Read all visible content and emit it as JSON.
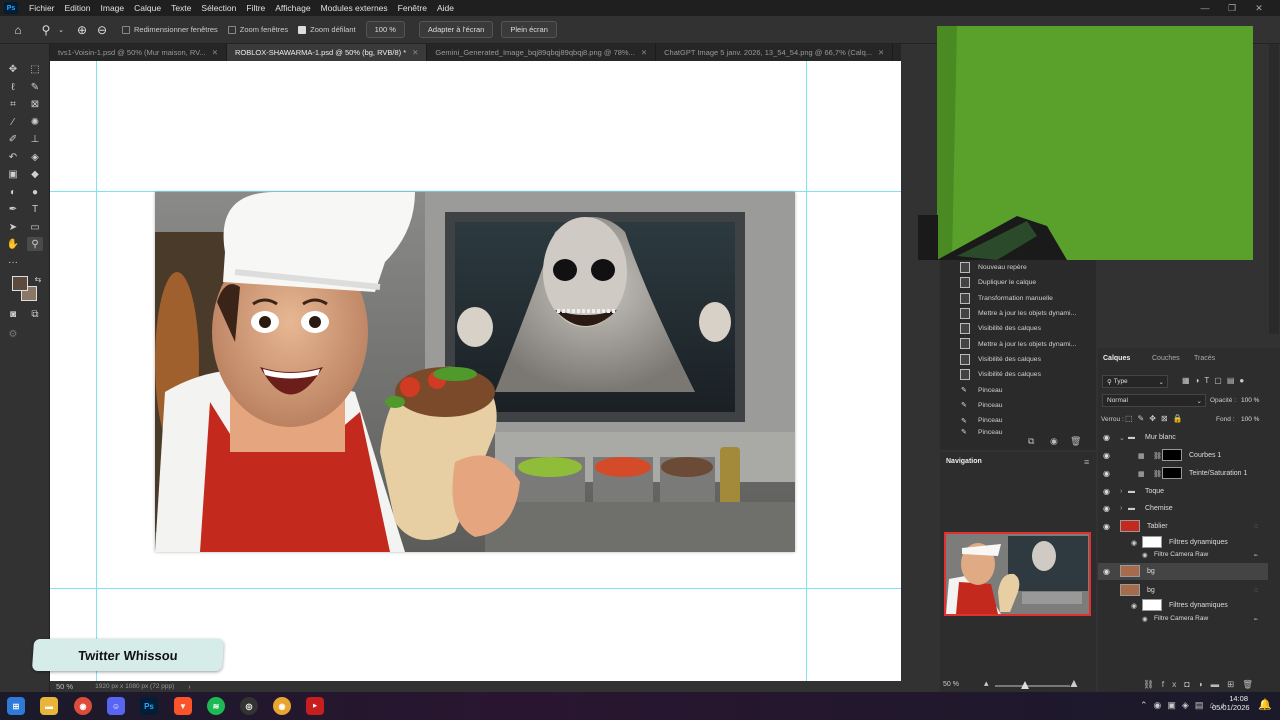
{
  "menu": [
    "Fichier",
    "Edition",
    "Image",
    "Calque",
    "Texte",
    "Sélection",
    "Filtre",
    "Affichage",
    "Modules externes",
    "Fenêtre",
    "Aide"
  ],
  "options": {
    "resize_windows": "Redimensionner fenêtres",
    "zoom_windows": "Zoom fenêtres",
    "scrubby_zoom": "Zoom défilant",
    "zoom_value": "100 %",
    "fit_screen": "Adapter à l'écran",
    "full_screen": "Plein écran"
  },
  "tabs": [
    {
      "label": "tvs1-Voisin-1.psd @ 50% (Mur maison, RV..."
    },
    {
      "label": "ROBLOX-SHAWARMA-1.psd @ 50% (bg, RVB/8) *"
    },
    {
      "label": "Gemini_Generated_Image_bqj89qbqj89qbqj8.png @ 78%..."
    },
    {
      "label": "ChatGPT Image 5 janv. 2026, 13_54_54.png @ 66,7% (Calq..."
    }
  ],
  "status": {
    "zoom": "50 %",
    "doc_size": "1920 px x 1080 px (72 ppp)"
  },
  "watermark": {
    "text": "Twitter Whissou"
  },
  "history": [
    "Nouveau repère",
    "Dupliquer le calque",
    "Transformation manuelle",
    "Mettre à jour les objets dynami...",
    "Visibilité des calques",
    "Mettre à jour les objets dynami...",
    "Visibilité des calques",
    "Visibilité des calques",
    "Pinceau",
    "Pinceau",
    "Pinceau",
    "Pinceau"
  ],
  "navigator": {
    "title": "Navigation",
    "zoom": "50 %"
  },
  "layers_panel": {
    "tabs": [
      "Calques",
      "Couches",
      "Tracés"
    ],
    "filter": "Type",
    "blend": "Normal",
    "opacity_label": "Opacité :",
    "opacity": "100 %",
    "lock_label": "Verrou :",
    "fill_label": "Fond :",
    "fill": "100 %",
    "layers": [
      {
        "name": "Mur blanc"
      },
      {
        "name": "Courbes 1"
      },
      {
        "name": "Teinte/Saturation 1"
      },
      {
        "name": "Toque"
      },
      {
        "name": "Chemise"
      },
      {
        "name": "Tablier"
      },
      {
        "name": "Filtres dynamiques"
      },
      {
        "name": "Filtre Camera Raw"
      },
      {
        "name": "bg"
      },
      {
        "name": "bg"
      },
      {
        "name": "Filtres dynamiques"
      },
      {
        "name": "Filtre Camera Raw"
      }
    ]
  },
  "clock": {
    "time": "14:08",
    "date": "05/01/2026"
  },
  "taskbar_icons": [
    "windows-start-icon",
    "file-explorer-icon",
    "chrome-icon",
    "discord-icon",
    "photoshop-icon",
    "brave-icon",
    "spotify-icon",
    "obs-icon",
    "chrome-canary-icon",
    "nvidia-icon"
  ],
  "taskbar_labels": {
    "photoshop": "Ps"
  },
  "colors": {
    "accent_guide": "#7fe3f0",
    "green_screen": "#5aa12b",
    "nav_frame": "#e03030"
  }
}
